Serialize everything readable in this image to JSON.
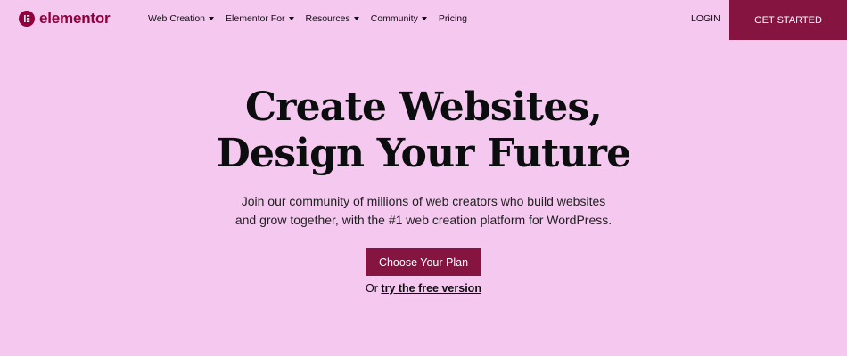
{
  "header": {
    "logo_text": "elementor",
    "nav": [
      {
        "label": "Web Creation"
      },
      {
        "label": "Elementor For"
      },
      {
        "label": "Resources"
      },
      {
        "label": "Community"
      },
      {
        "label": "Pricing"
      }
    ],
    "login_label": "LOGIN",
    "get_started_label": "GET STARTED"
  },
  "hero": {
    "title_line1": "Create Websites,",
    "title_line2": "Design Your Future",
    "subtitle_line1": "Join our community of millions of web creators who build websites",
    "subtitle_line2": "and grow together, with the #1 web creation platform for WordPress.",
    "cta_label": "Choose Your Plan",
    "alt_prefix": "Or",
    "alt_link": "try the free version"
  },
  "colors": {
    "background": "#f5c8f0",
    "brand": "#861440",
    "logo": "#92003b"
  },
  "icons": [
    "elementor-logo-icon",
    "chevron-down-icon"
  ]
}
